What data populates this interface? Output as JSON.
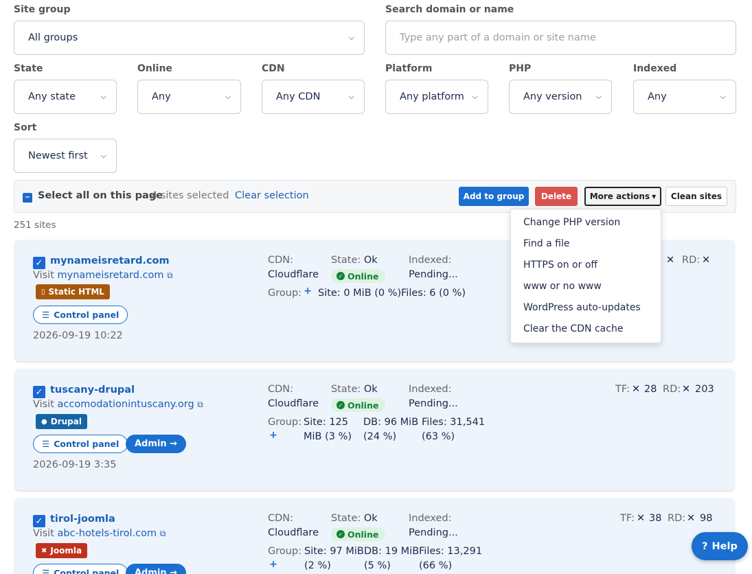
{
  "filters": {
    "site_group": {
      "label": "Site group",
      "value": "All groups"
    },
    "search": {
      "label": "Search domain or name",
      "placeholder": "Type any part of a domain or site name"
    },
    "state": {
      "label": "State",
      "value": "Any state"
    },
    "online": {
      "label": "Online",
      "value": "Any"
    },
    "cdn": {
      "label": "CDN",
      "value": "Any CDN"
    },
    "platform": {
      "label": "Platform",
      "value": "Any platform"
    },
    "php": {
      "label": "PHP",
      "value": "Any version"
    },
    "indexed": {
      "label": "Indexed",
      "value": "Any"
    },
    "sort": {
      "label": "Sort",
      "value": "Newest first"
    }
  },
  "bulk": {
    "select_all": "Select all on this page",
    "selected": "4 sites selected",
    "clear": "Clear selection",
    "add_to_group": "Add to group",
    "delete": "Delete",
    "more_actions": "More actions",
    "clean_sites": "Clean sites"
  },
  "count": "251 sites",
  "more_menu": [
    "Change PHP version",
    "Find a file",
    "HTTPS on or off",
    "www or no www",
    "WordPress auto-updates",
    "Clear the CDN cache"
  ],
  "labels": {
    "visit": "Visit",
    "cdn": "CDN:",
    "state": "State:",
    "indexed": "Indexed:",
    "group": "Group:",
    "tf": "TF:",
    "rd": "RD:",
    "control_panel": "Control panel",
    "admin": "Admin →",
    "help": "Help"
  },
  "sites": [
    {
      "name": "mynameisretard.com",
      "domain": "mynameisretard.com",
      "platform": "Static HTML",
      "platform_color": "#a8580e",
      "has_admin": false,
      "date": "2026-09-19 10:22",
      "cdn": "Cloudflare",
      "state": "Ok",
      "online": "Online",
      "indexed": "Pending...",
      "site": "Site: 0 MiB (0 %)",
      "db": "",
      "files": "Files: 6 (0 %)",
      "tf": "",
      "rd": ""
    },
    {
      "name": "tuscany-drupal",
      "domain": "accomodationintuscany.org",
      "platform": "Drupal",
      "platform_color": "#1565a6",
      "has_admin": true,
      "date": "2026-09-19 3:35",
      "cdn": "Cloudflare",
      "state": "Ok",
      "online": "Online",
      "indexed": "Pending...",
      "site1": "Site: 125",
      "site2": "MiB (3 %)",
      "db1": "DB: 96 MiB",
      "db2": "(24 %)",
      "files1": "Files: 31,541",
      "files2": "(63 %)",
      "tf": "28",
      "rd": "203"
    },
    {
      "name": "tirol-joomla",
      "domain": "abc-hotels-tirol.com",
      "platform": "Joomla",
      "platform_color": "#c0321f",
      "has_admin": true,
      "date": "",
      "cdn": "Cloudflare",
      "state": "Ok",
      "online": "Online",
      "indexed": "Pending...",
      "site1": "Site: 97 MiB",
      "site2": "(2 %)",
      "db1": "DB: 19 MiB",
      "db2": "(5 %)",
      "files1": "Files: 13,291",
      "files2": "(66 %)",
      "tf": "38",
      "rd": "98"
    }
  ]
}
